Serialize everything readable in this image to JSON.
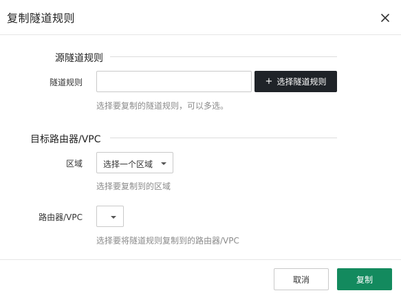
{
  "dialog": {
    "title": "复制隧道规则",
    "close_icon": "close-icon"
  },
  "source_section": {
    "title": "源隧道规则",
    "tunnel_rule_label": "隧道规则",
    "tunnel_rule_value": "",
    "tunnel_rule_placeholder": "",
    "select_button_icon": "plus-icon",
    "select_button_label": "选择隧道规则",
    "help_text": "选择要复制的隧道规则，可以多选。"
  },
  "target_section": {
    "title": "目标路由器/VPC",
    "region_label": "区域",
    "region_value": "选择一个区域",
    "region_help": "选择要复制到的区域",
    "router_label": "路由器/VPC",
    "router_value": "",
    "router_help": "选择要将隧道规则复制到的路由器/VPC"
  },
  "footer": {
    "cancel_label": "取消",
    "copy_label": "复制"
  },
  "colors": {
    "primary_button": "#138a5e",
    "dark_button": "#1f2328",
    "help_text": "#8a8a8a"
  }
}
